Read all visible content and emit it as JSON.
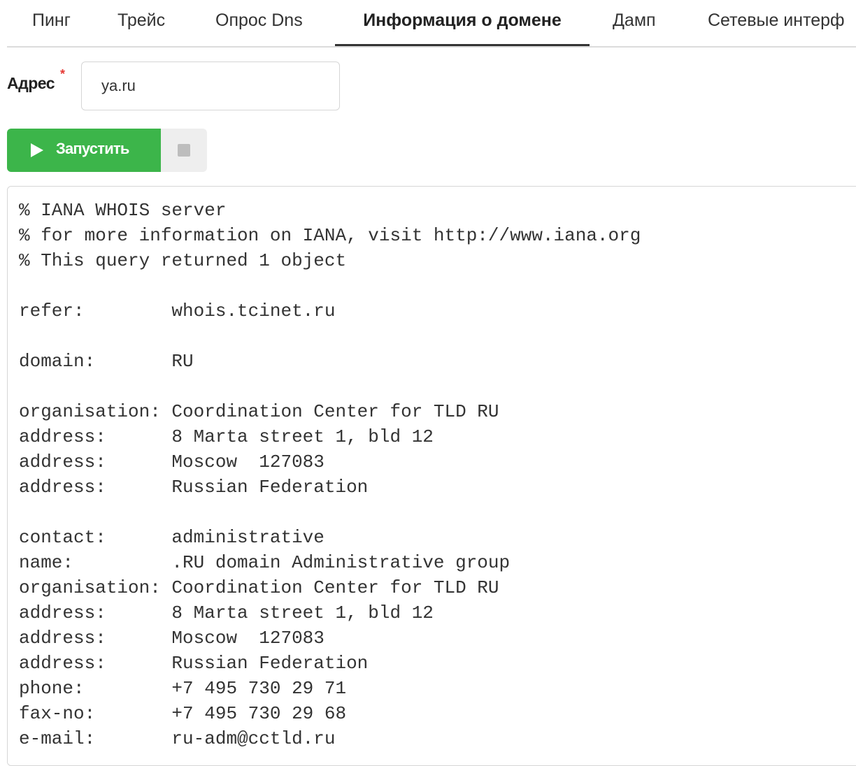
{
  "tabs": [
    {
      "label": "Пинг",
      "active": false
    },
    {
      "label": "Трейс",
      "active": false
    },
    {
      "label": "Опрос Dns",
      "active": false
    },
    {
      "label": "Информация о домене",
      "active": true
    },
    {
      "label": "Дамп",
      "active": false
    },
    {
      "label": "Сетевые интерф",
      "active": false
    }
  ],
  "form": {
    "address_label": "Адрес",
    "required_mark": "*",
    "address_value": "ya.ru"
  },
  "actions": {
    "run_label": "Запустить",
    "run_icon": "play-icon",
    "stop_icon": "stop-icon",
    "run_color": "#3cb54a"
  },
  "output": {
    "lines": [
      "% IANA WHOIS server",
      "% for more information on IANA, visit http://www.iana.org",
      "% This query returned 1 object",
      "",
      "refer:        whois.tcinet.ru",
      "",
      "domain:       RU",
      "",
      "organisation: Coordination Center for TLD RU",
      "address:      8 Marta street 1, bld 12",
      "address:      Moscow  127083",
      "address:      Russian Federation",
      "",
      "contact:      administrative",
      "name:         .RU domain Administrative group",
      "organisation: Coordination Center for TLD RU",
      "address:      8 Marta street 1, bld 12",
      "address:      Moscow  127083",
      "address:      Russian Federation",
      "phone:        +7 495 730 29 71",
      "fax-no:       +7 495 730 29 68",
      "e-mail:       ru-adm@cctld.ru"
    ]
  }
}
